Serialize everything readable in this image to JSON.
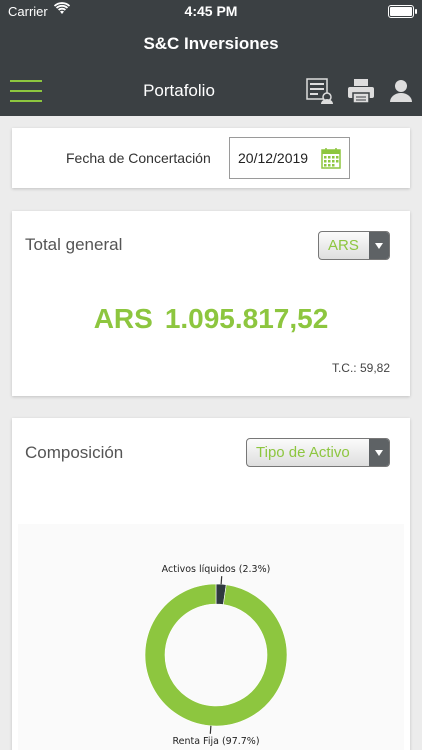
{
  "status_bar": {
    "carrier": "Carrier",
    "time": "4:45 PM"
  },
  "app_title": "S&C Inversiones",
  "nav": {
    "title": "Portafolio",
    "icons": [
      "menu-icon",
      "report-icon",
      "printer-icon",
      "user-icon"
    ]
  },
  "fecha": {
    "label": "Fecha de Concertación",
    "value": "20/12/2019"
  },
  "total": {
    "title": "Total general",
    "currency_select": "ARS",
    "amount_currency": "ARS",
    "amount": "1.095.817,52",
    "tc": "T.C.: 59,82"
  },
  "composicion": {
    "title": "Composición",
    "select": "Tipo de Activo"
  },
  "colors": {
    "accent": "#8dc63f",
    "header": "#3b4043",
    "slice_dark": "#2f3a3f"
  },
  "chart_data": {
    "type": "pie",
    "categories": [
      "Activos líquidos",
      "Renta Fija"
    ],
    "values": [
      2.3,
      97.7
    ],
    "labels": [
      "Activos líquidos (2.3%)",
      "Renta Fija (97.7%)"
    ],
    "colors": [
      "#2f3a3f",
      "#8dc63f"
    ]
  }
}
